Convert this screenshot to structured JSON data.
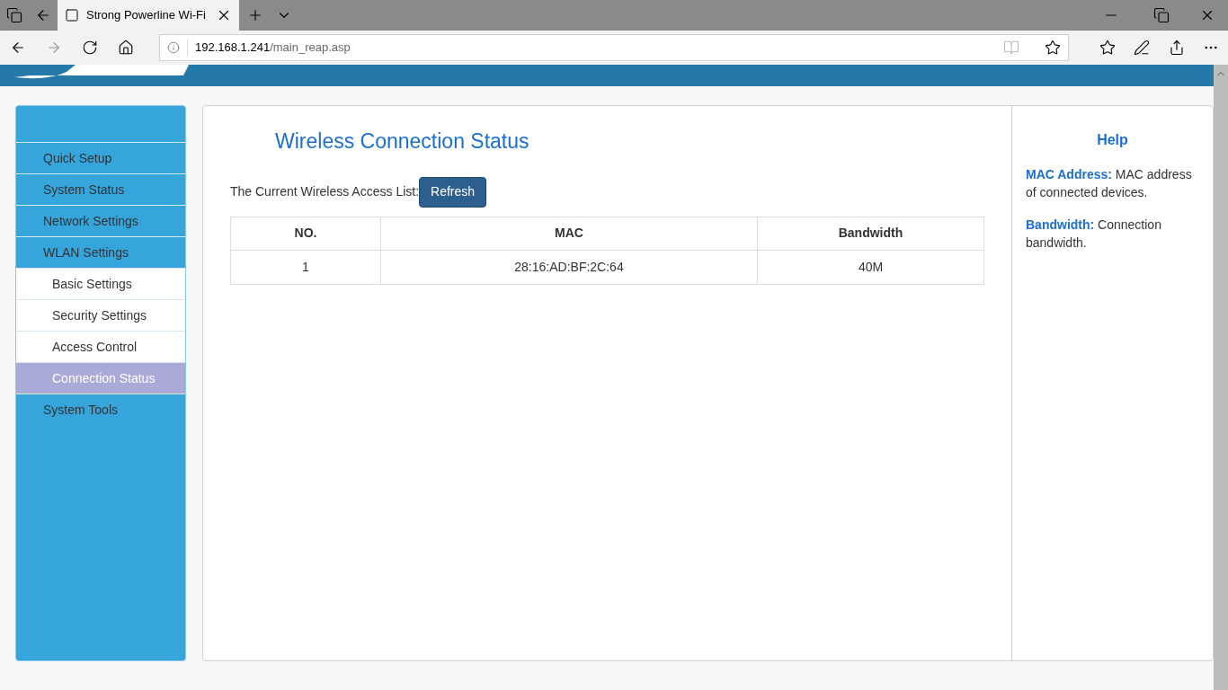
{
  "browser": {
    "tab_title": "Strong Powerline Wi-Fi",
    "url_host": "192.168.1.241",
    "url_path": "/main_reap.asp"
  },
  "sidebar": {
    "items": [
      {
        "label": "Quick Setup",
        "kind": "main",
        "selected": false
      },
      {
        "label": "System Status",
        "kind": "main",
        "selected": false
      },
      {
        "label": "Network Settings",
        "kind": "main",
        "selected": false
      },
      {
        "label": "WLAN Settings",
        "kind": "main",
        "selected": false
      },
      {
        "label": "Basic Settings",
        "kind": "sub",
        "selected": false
      },
      {
        "label": "Security Settings",
        "kind": "sub",
        "selected": false
      },
      {
        "label": "Access Control",
        "kind": "sub",
        "selected": false
      },
      {
        "label": "Connection Status",
        "kind": "sub",
        "selected": true
      },
      {
        "label": "System Tools",
        "kind": "main",
        "selected": false
      }
    ]
  },
  "main": {
    "title": "Wireless Connection Status",
    "list_label": "The Current Wireless Access List:",
    "refresh_button": "Refresh",
    "table": {
      "columns": [
        "NO.",
        "MAC",
        "Bandwidth"
      ],
      "rows": [
        [
          "1",
          "28:16:AD:BF:2C:64",
          "40M"
        ]
      ]
    }
  },
  "help": {
    "title": "Help",
    "entries": [
      "**MAC Address:** MAC address of connected devices.",
      "**Bandwidth:** Connection bandwidth."
    ]
  }
}
